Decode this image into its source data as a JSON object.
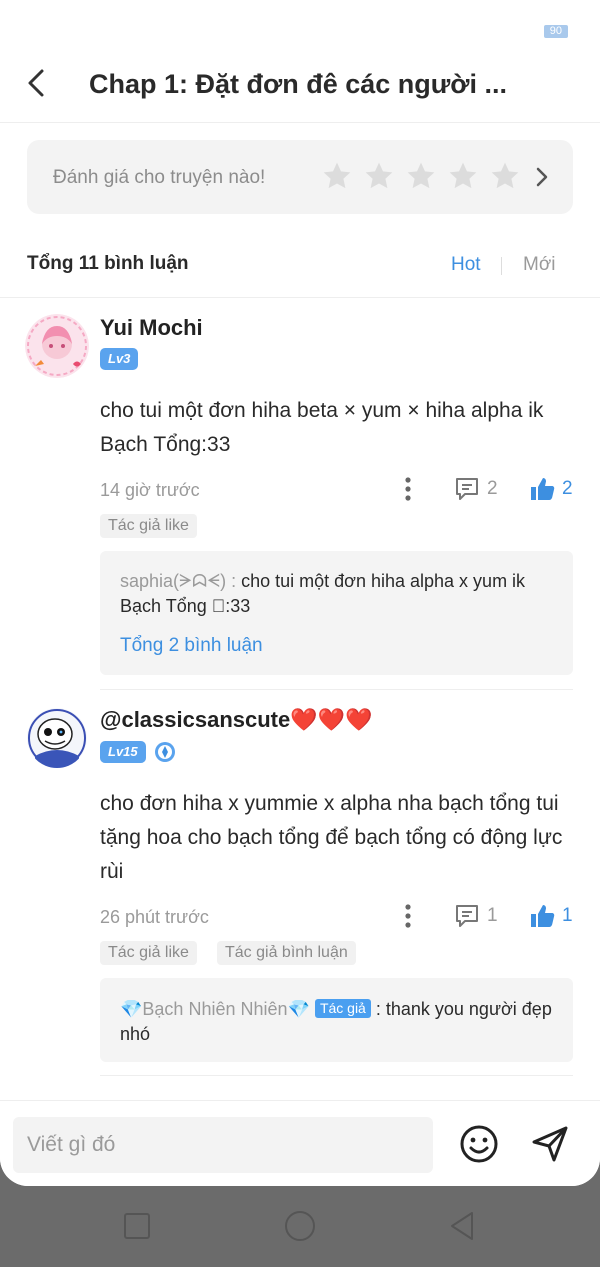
{
  "status_bar": {
    "badge": "90"
  },
  "header": {
    "title": "Chap 1: Đặt đơn đê các người ..."
  },
  "rating": {
    "prompt": "Đánh giá cho truyện nào!",
    "stars": 5
  },
  "comments_summary": {
    "total": "Tổng 11 bình luận",
    "sort_hot": "Hot",
    "sort_new": "Mới"
  },
  "comments": [
    {
      "username": "Yui Mochi",
      "level": "Lv3",
      "content": "cho tui một đơn hiha beta × yum × hiha alpha ik Bạch Tổng:33",
      "time": "14 giờ trước",
      "reply_count": "2",
      "like_count": "2",
      "tags": [
        "Tác giả like"
      ],
      "reply": {
        "author": "saphia(ᗒᗣᗕ) : ",
        "text": "cho tui một đơn hiha alpha x yum ik Bạch Tổng \u0000:33",
        "total": "Tổng 2 bình luận"
      }
    },
    {
      "username": "@classicsanscute❤️❤️❤️",
      "level": "Lv15",
      "content": "cho đơn hiha x yummie x alpha nha bạch tổng tui tặng hoa cho bạch tổng để bạch tổng có động lực rùi",
      "time": "26 phút trước",
      "reply_count": "1",
      "like_count": "1",
      "tags": [
        "Tác giả like",
        "Tác giả bình luận"
      ],
      "reply": {
        "author": "💎Bạch Nhiên Nhiên💎",
        "author_tag": "Tác giả",
        "text": " : thank you người đẹp nhó"
      }
    }
  ],
  "composer": {
    "placeholder": "Viết gì đó"
  },
  "colors": {
    "accent": "#3d8fe0",
    "level_badge": "#5aa3ee",
    "muted": "#9a9a9a"
  }
}
